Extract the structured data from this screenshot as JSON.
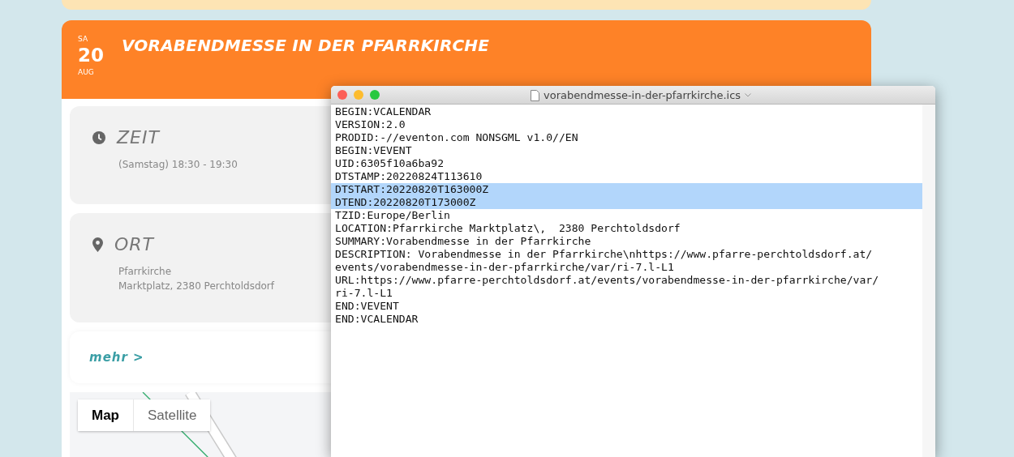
{
  "event": {
    "weekday": "SA",
    "day": "20",
    "month": "AUG",
    "title": "VORABENDMESSE IN DER PFARRKIRCHE"
  },
  "info_cards": [
    {
      "kind": "time",
      "heading": "ZEIT",
      "lines": [
        "(Samstag) 18:30 - 19:30"
      ]
    },
    {
      "kind": "place",
      "heading": "ORT",
      "lines": [
        "Pfarrkirche",
        "Marktplatz, 2380 Perchtoldsdorf"
      ]
    }
  ],
  "more_link": "mehr >",
  "map": {
    "tabs": [
      {
        "label": "Map",
        "selected": true
      },
      {
        "label": "Satellite",
        "selected": false
      }
    ]
  },
  "editor": {
    "title": "vorabendmesse-in-der-pfarrkirche.ics",
    "lines": [
      {
        "text": "BEGIN:VCALENDAR",
        "selected": false
      },
      {
        "text": "VERSION:2.0",
        "selected": false
      },
      {
        "text": "PRODID:-//eventon.com NONSGML v1.0//EN",
        "selected": false
      },
      {
        "text": "BEGIN:VEVENT",
        "selected": false
      },
      {
        "text": "UID:6305f10a6ba92",
        "selected": false
      },
      {
        "text": "DTSTAMP:20220824T113610",
        "selected": false
      },
      {
        "text": "DTSTART:20220820T163000Z",
        "selected": true
      },
      {
        "text": "DTEND:20220820T173000Z",
        "selected": true
      },
      {
        "text": "TZID:Europe/Berlin",
        "selected": false
      },
      {
        "text": "LOCATION:Pfarrkirche Marktplatz\\,  2380 Perchtoldsdorf",
        "selected": false
      },
      {
        "text": "SUMMARY:Vorabendmesse in der Pfarrkirche",
        "selected": false
      },
      {
        "text": "DESCRIPTION: Vorabendmesse in der Pfarrkirche\\nhttps://www.pfarre-perchtoldsdorf.at/",
        "selected": false
      },
      {
        "text": "events/vorabendmesse-in-der-pfarrkirche/var/ri-7.l-L1",
        "selected": false
      },
      {
        "text": "URL:https://www.pfarre-perchtoldsdorf.at/events/vorabendmesse-in-der-pfarrkirche/var/",
        "selected": false
      },
      {
        "text": "ri-7.l-L1",
        "selected": false
      },
      {
        "text": "END:VEVENT",
        "selected": false
      },
      {
        "text": "END:VCALENDAR",
        "selected": false
      }
    ]
  }
}
